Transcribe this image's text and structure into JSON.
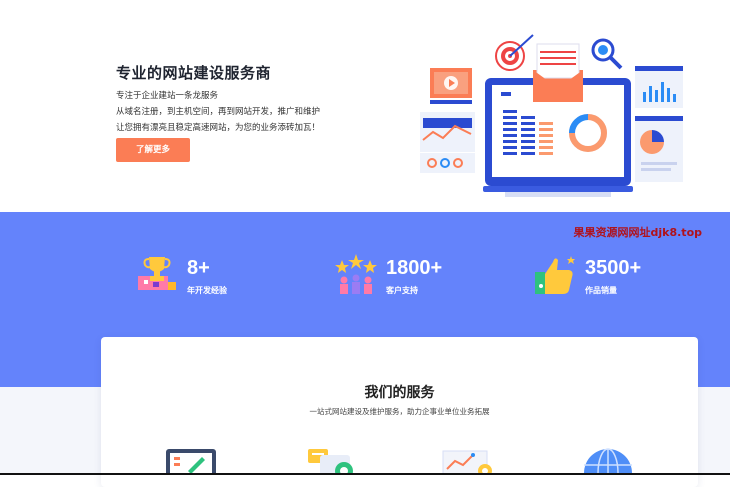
{
  "hero": {
    "title": "专业的网站建设服务商",
    "subtitle": "专注于企业建站一条龙服务",
    "desc": "从域名注册，到主机空间，再到网站开发，推广和维护让您拥有漂亮且稳定高速网站，为您的业务添砖加瓦！",
    "button": "了解更多"
  },
  "watermark": "果果资源网网址djk8.top",
  "stats": [
    {
      "num": "8+",
      "label": "年开发经验",
      "icon": "trophy-icon"
    },
    {
      "num": "1800+",
      "label": "客户支持",
      "icon": "customers-stars-icon"
    },
    {
      "num": "3500+",
      "label": "作品销量",
      "icon": "thumbs-up-icon"
    }
  ],
  "services": {
    "title": "我们的服务",
    "subtitle": "一站式网站建设及维护服务，助力企事业单位业务拓展",
    "icons": [
      "design-icon",
      "chat-support-icon",
      "chart-report-icon",
      "globe-icon"
    ]
  },
  "colors": {
    "accent": "#fb7d55",
    "stats_bg": "#6483fb",
    "watermark": "#b0121b"
  }
}
